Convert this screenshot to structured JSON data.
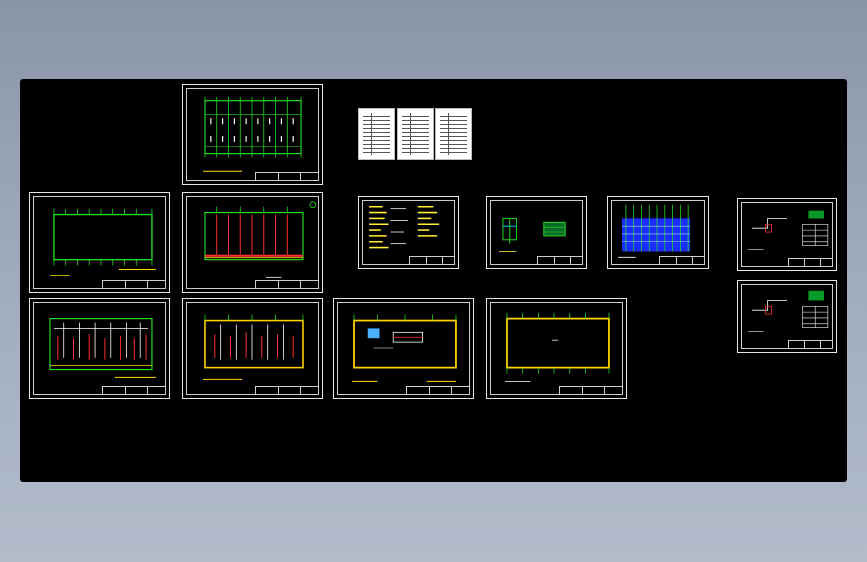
{
  "canvas": {
    "background": "#000000",
    "colors": {
      "sheet_border": "#e6e6e6",
      "grid_green": "#22dd22",
      "axis_red": "#ff3333",
      "wall_yellow": "#ffd400",
      "panel_blue": "#1a2cff",
      "note_yellow": "#ffee33",
      "table_white": "#ffffff"
    }
  },
  "sheets": [
    {
      "id": "s1",
      "kind": "plan-grid"
    },
    {
      "id": "s2",
      "kind": "plan-empty"
    },
    {
      "id": "s3",
      "kind": "plan-columns"
    },
    {
      "id": "s4",
      "kind": "table-list"
    },
    {
      "id": "s5",
      "kind": "table-list"
    },
    {
      "id": "s6",
      "kind": "table-list"
    },
    {
      "id": "s7",
      "kind": "notes"
    },
    {
      "id": "s8",
      "kind": "detail"
    },
    {
      "id": "s9",
      "kind": "panel-schedule"
    },
    {
      "id": "s10",
      "kind": "system-diagram"
    },
    {
      "id": "s11",
      "kind": "system-diagram"
    },
    {
      "id": "s12",
      "kind": "plan-rooms"
    },
    {
      "id": "s13",
      "kind": "plan-rooms"
    },
    {
      "id": "s14",
      "kind": "plan-perimeter"
    },
    {
      "id": "s15",
      "kind": "plan-perimeter"
    }
  ]
}
